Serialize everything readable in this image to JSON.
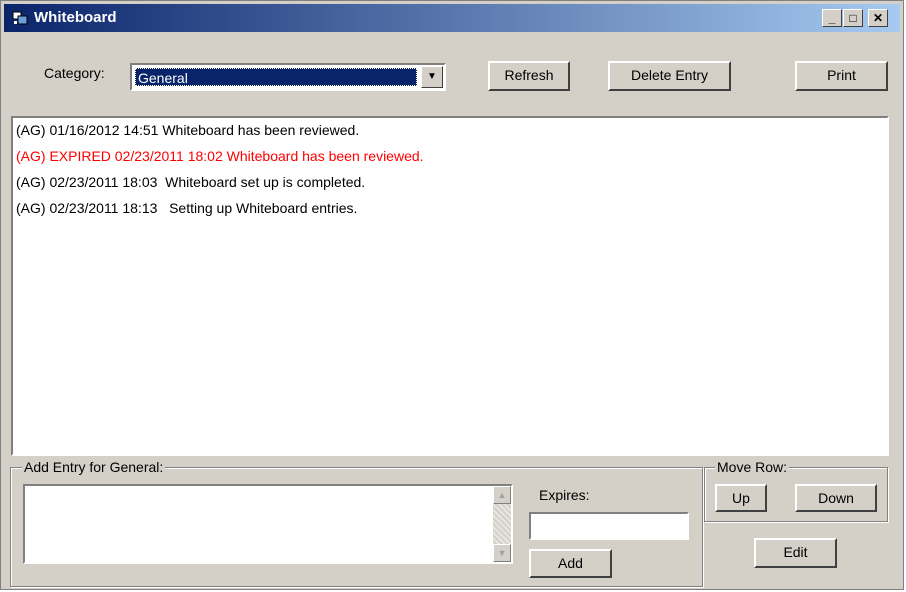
{
  "window": {
    "title": "Whiteboard",
    "minimize": "_",
    "maximize": "□",
    "close": "✕"
  },
  "toolbar": {
    "category_label": "Category:",
    "category_value": "General",
    "refresh": "Refresh",
    "delete_entry": "Delete Entry",
    "print": "Print"
  },
  "entries": [
    {
      "text": "(AG) 01/16/2012 14:51 Whiteboard has been reviewed.",
      "color": "#000000"
    },
    {
      "text": "(AG) EXPIRED 02/23/2011 18:02 Whiteboard has been reviewed.",
      "color": "#ff0000"
    },
    {
      "text": "(AG) 02/23/2011 18:03  Whiteboard set up is completed.",
      "color": "#000000"
    },
    {
      "text": "(AG) 02/23/2011 18:13   Setting up Whiteboard entries.",
      "color": "#000000"
    }
  ],
  "add_entry": {
    "legend": "Add Entry for General:",
    "expires_label": "Expires:",
    "expires_value": "",
    "add": "Add"
  },
  "move_row": {
    "legend": "Move Row:",
    "up": "Up",
    "down": "Down"
  },
  "edit": "Edit"
}
